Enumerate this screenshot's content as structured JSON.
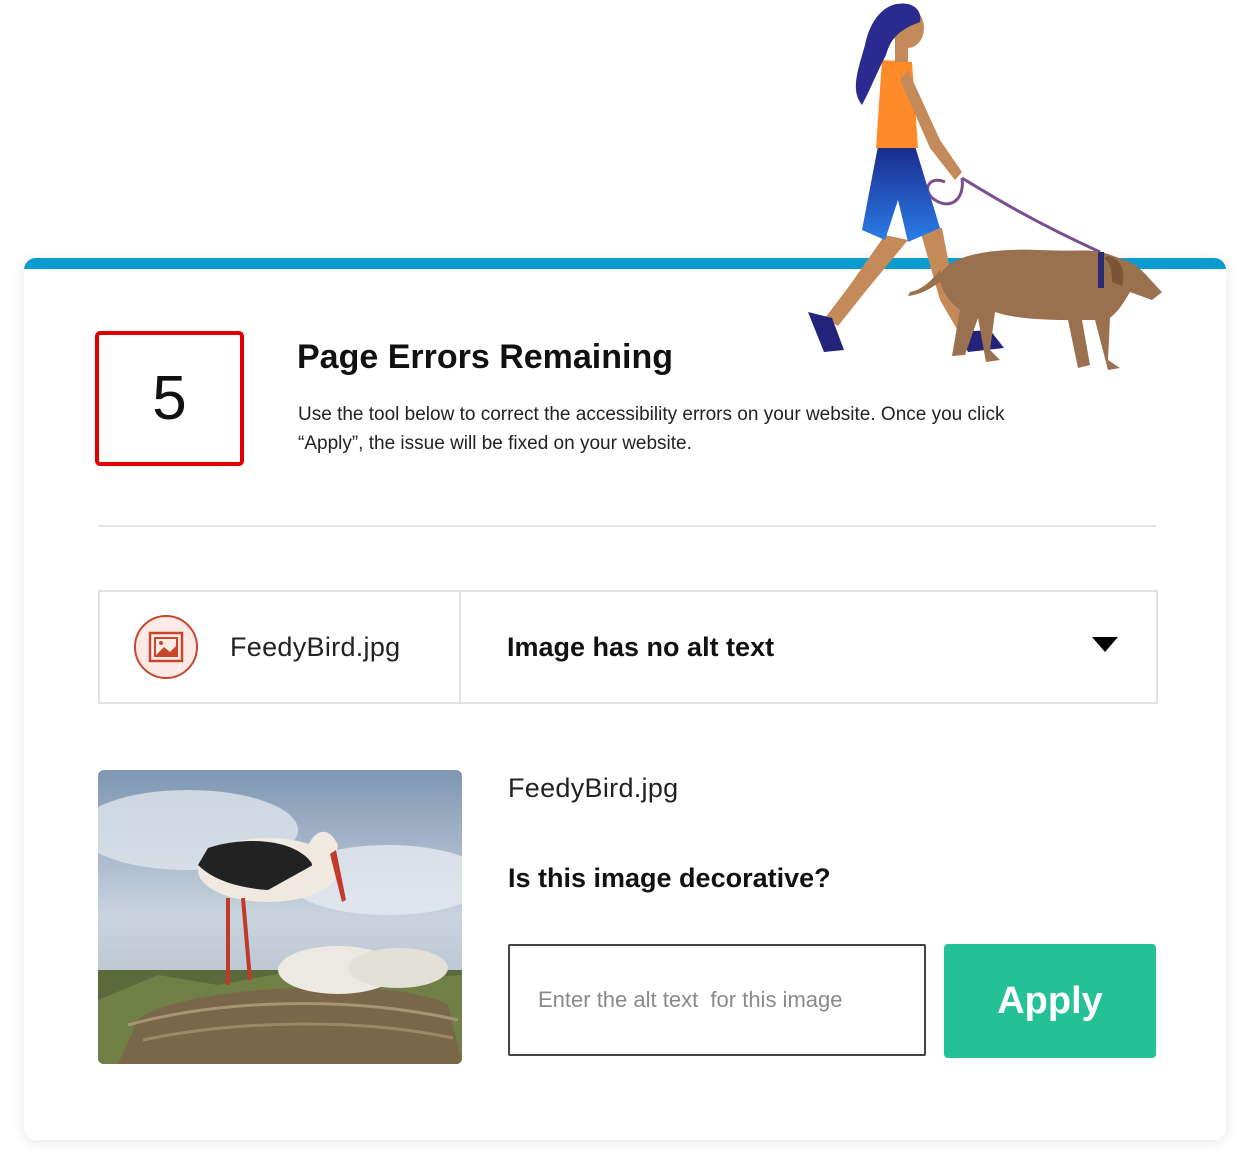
{
  "colors": {
    "accent_bar": "#0a9bd0",
    "error_border": "#e00000",
    "apply_bg": "#24c096",
    "icon_accent": "#c7462e"
  },
  "error_count": "5",
  "header": {
    "title": "Page Errors Remaining",
    "description": "Use the tool below to correct the accessibility errors on your website. Once you click “Apply”, the issue will be fixed on your website."
  },
  "issue": {
    "icon": "image-icon",
    "file_name": "FeedyBird.jpg",
    "label": "Image has no alt text",
    "dropdown_icon": "triangle-down-icon"
  },
  "detail": {
    "file_name": "FeedyBird.jpg",
    "question": "Is this image decorative?",
    "alt_placeholder": "Enter the alt text  for this image",
    "apply_label": "Apply"
  }
}
